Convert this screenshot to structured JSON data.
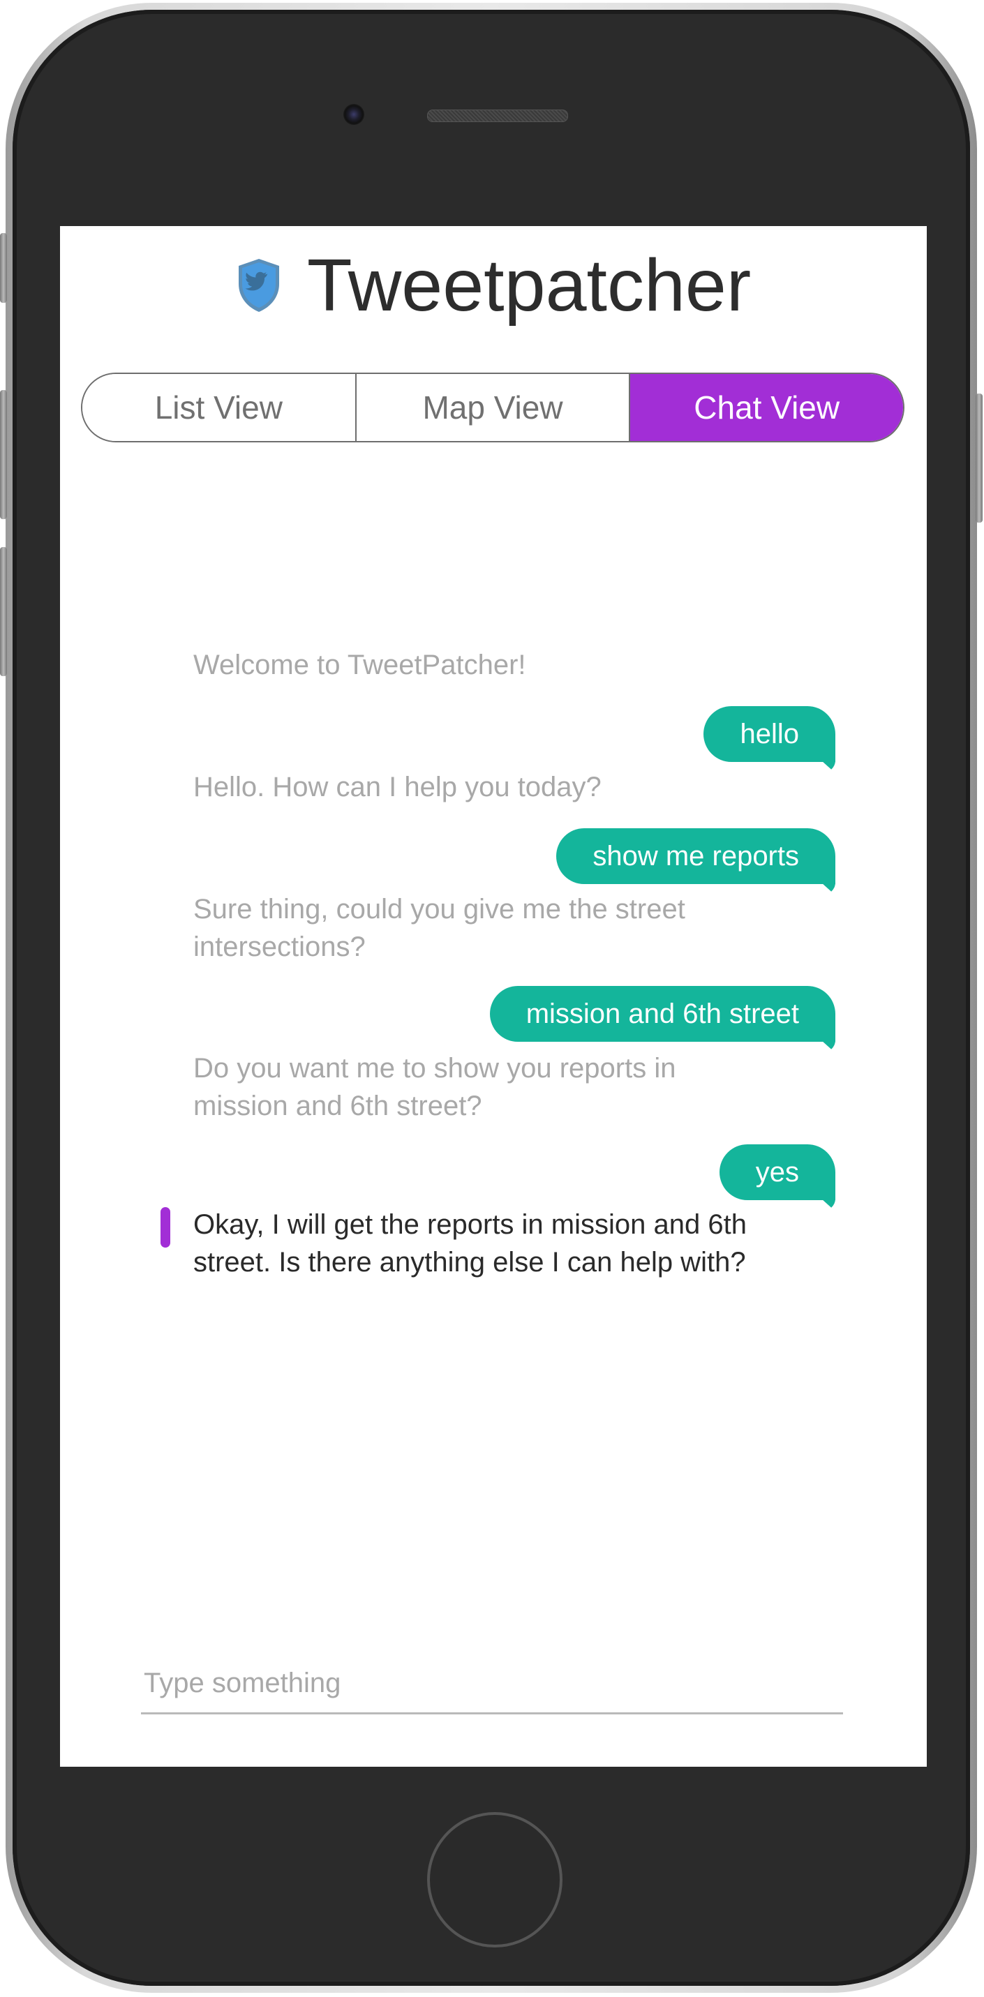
{
  "app": {
    "title": "Tweetpatcher"
  },
  "tabs": [
    {
      "label": "List View",
      "active": false
    },
    {
      "label": "Map View",
      "active": false
    },
    {
      "label": "Chat View",
      "active": true
    }
  ],
  "chat": {
    "messages": [
      {
        "from": "bot",
        "text": "Welcome to TweetPatcher!"
      },
      {
        "from": "user",
        "text": "hello"
      },
      {
        "from": "bot",
        "text": "Hello. How can I help you today?"
      },
      {
        "from": "user",
        "text": "show me reports"
      },
      {
        "from": "bot",
        "text": "Sure thing, could you give me the street intersections?"
      },
      {
        "from": "user",
        "text": "mission and 6th street"
      },
      {
        "from": "bot",
        "text": "Do you want me to show you reports in mission and 6th street?"
      },
      {
        "from": "user",
        "text": "yes"
      },
      {
        "from": "bot",
        "text": "Okay, I will get the reports in mission and 6th street. Is there anything else I can help with?",
        "current": true
      }
    ]
  },
  "input": {
    "placeholder": "Type something",
    "value": ""
  },
  "colors": {
    "accent": "#a22ed6",
    "user_bubble": "#14b59b",
    "bot_text_muted": "#a8a8a8",
    "bot_text_current": "#2a2a2a"
  },
  "icons": {
    "logo": "twitter-bird-shield-icon"
  }
}
